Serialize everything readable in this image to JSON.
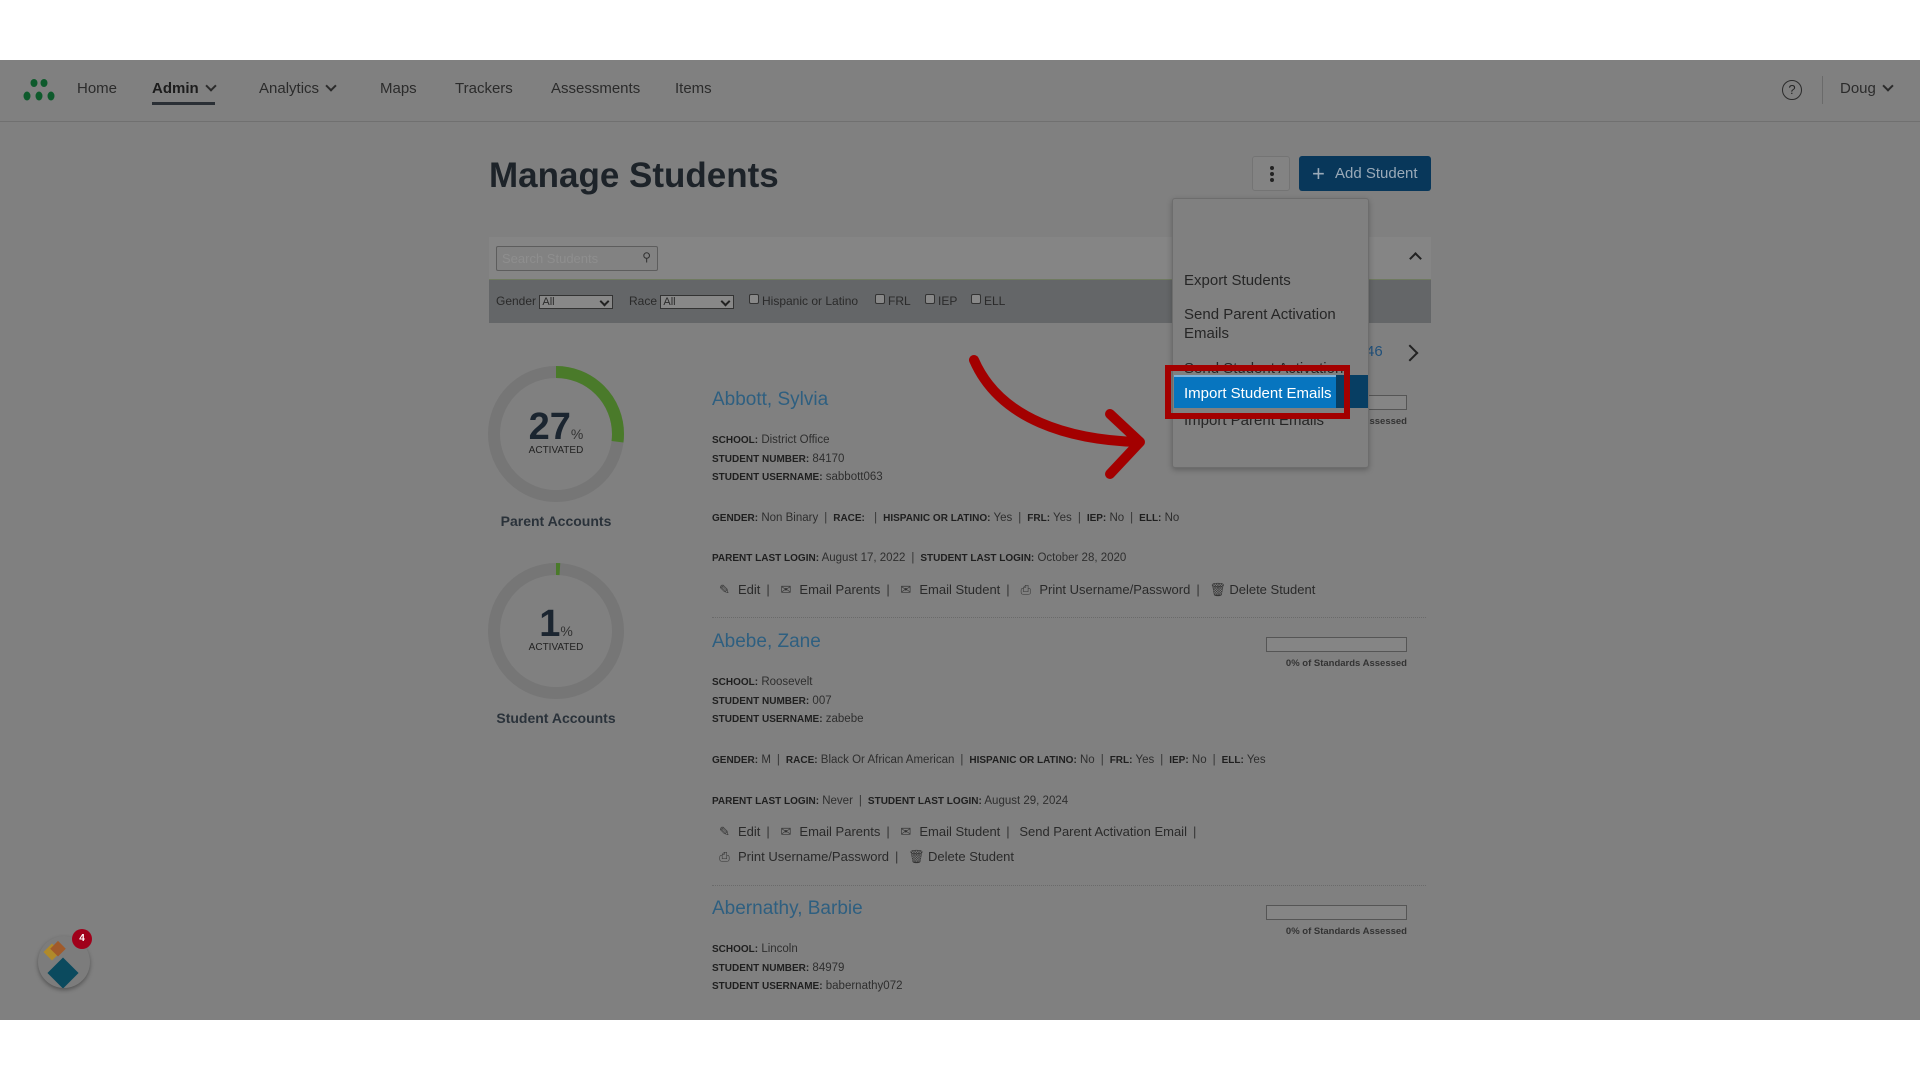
{
  "nav": {
    "items": [
      {
        "label": "Home"
      },
      {
        "label": "Admin",
        "active": true
      },
      {
        "label": "Analytics"
      },
      {
        "label": "Maps"
      },
      {
        "label": "Trackers"
      },
      {
        "label": "Assessments"
      },
      {
        "label": "Items"
      }
    ],
    "user": "Doug",
    "help_icon": "help-circle-icon"
  },
  "page": {
    "title": "Manage Students",
    "add_button": "Add Student"
  },
  "filters": {
    "search_placeholder": "Search Students",
    "gender_label": "Gender",
    "gender_value": "All",
    "race_label": "Race",
    "race_value": "All",
    "checkboxes": [
      "Hispanic or Latino",
      "FRL",
      "IEP",
      "ELL"
    ]
  },
  "menu": {
    "items": [
      "Export Students",
      "Send Parent Activation Emails",
      "Send Student Activation Emails",
      "Import Parent Emails",
      "Import Student Emails"
    ],
    "highlighted": "Import Student Emails"
  },
  "pagination": {
    "last_page": "46"
  },
  "stats": [
    {
      "value": "27",
      "unit": "%",
      "sub": "ACTIVATED",
      "label": "Parent Accounts",
      "percent": 27
    },
    {
      "value": "1",
      "unit": "%",
      "sub": "ACTIVATED",
      "label": "Student Accounts",
      "percent": 1
    }
  ],
  "labels": {
    "school": "SCHOOL:",
    "number": "STUDENT NUMBER:",
    "username": "STUDENT USERNAME:",
    "gender": "GENDER:",
    "race": "RACE:",
    "hisp": "HISPANIC OR LATINO:",
    "frl": "FRL:",
    "iep": "IEP:",
    "ell": "ELL:",
    "plogin": "PARENT LAST LOGIN:",
    "slogin": "STUDENT LAST LOGIN:",
    "assessed": "0% of Standards Assessed"
  },
  "actions": {
    "edit": "Edit",
    "email_parents": "Email Parents",
    "email_student": "Email Student",
    "send_parent_activation": "Send Parent Activation Email",
    "print": "Print Username/Password",
    "delete": "Delete Student"
  },
  "students": [
    {
      "name": "Abbott, Sylvia",
      "school": "District Office",
      "number": "84170",
      "username": "sabbott063",
      "gender": "Non Binary",
      "race": "",
      "hisp": "Yes",
      "frl": "Yes",
      "iep": "No",
      "ell": "No",
      "plogin": "August 17, 2022",
      "slogin": "October 28, 2020",
      "assessed": 0
    },
    {
      "name": "Abebe, Zane",
      "school": "Roosevelt",
      "number": "007",
      "username": "zabebe",
      "gender": "M",
      "race": "Black Or African American",
      "hisp": "No",
      "frl": "Yes",
      "iep": "No",
      "ell": "Yes",
      "plogin": "Never",
      "slogin": "August 29, 2024",
      "assessed": 0
    },
    {
      "name": "Abernathy, Barbie",
      "school": "Lincoln",
      "number": "84979",
      "username": "babernathy072",
      "assessed": 0
    }
  ],
  "widget": {
    "badge": "4"
  },
  "colors": {
    "accent": "#0775bf",
    "highlight_box": "#a30000",
    "progress": "#4a7a2a"
  }
}
